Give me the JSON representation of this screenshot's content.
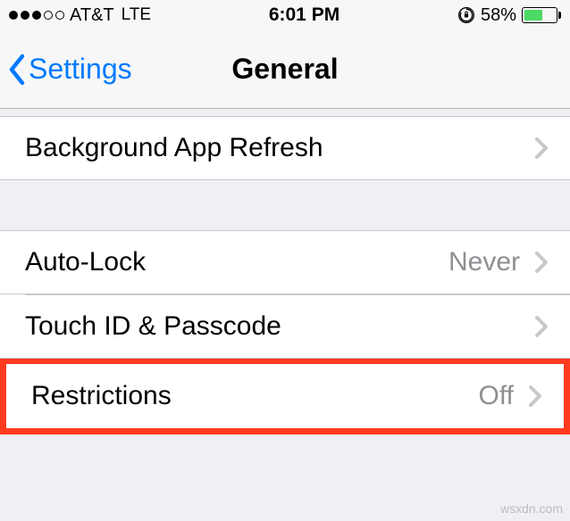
{
  "status": {
    "carrier": "AT&T",
    "network": "LTE",
    "time": "6:01 PM",
    "battery_pct": "58%",
    "battery_level": 0.58
  },
  "nav": {
    "back_label": "Settings",
    "title": "General"
  },
  "rows": {
    "bg_refresh": "Background App Refresh",
    "auto_lock": "Auto-Lock",
    "auto_lock_value": "Never",
    "touch_id": "Touch ID & Passcode",
    "restrictions": "Restrictions",
    "restrictions_value": "Off"
  },
  "watermark": "wsxdn.com"
}
